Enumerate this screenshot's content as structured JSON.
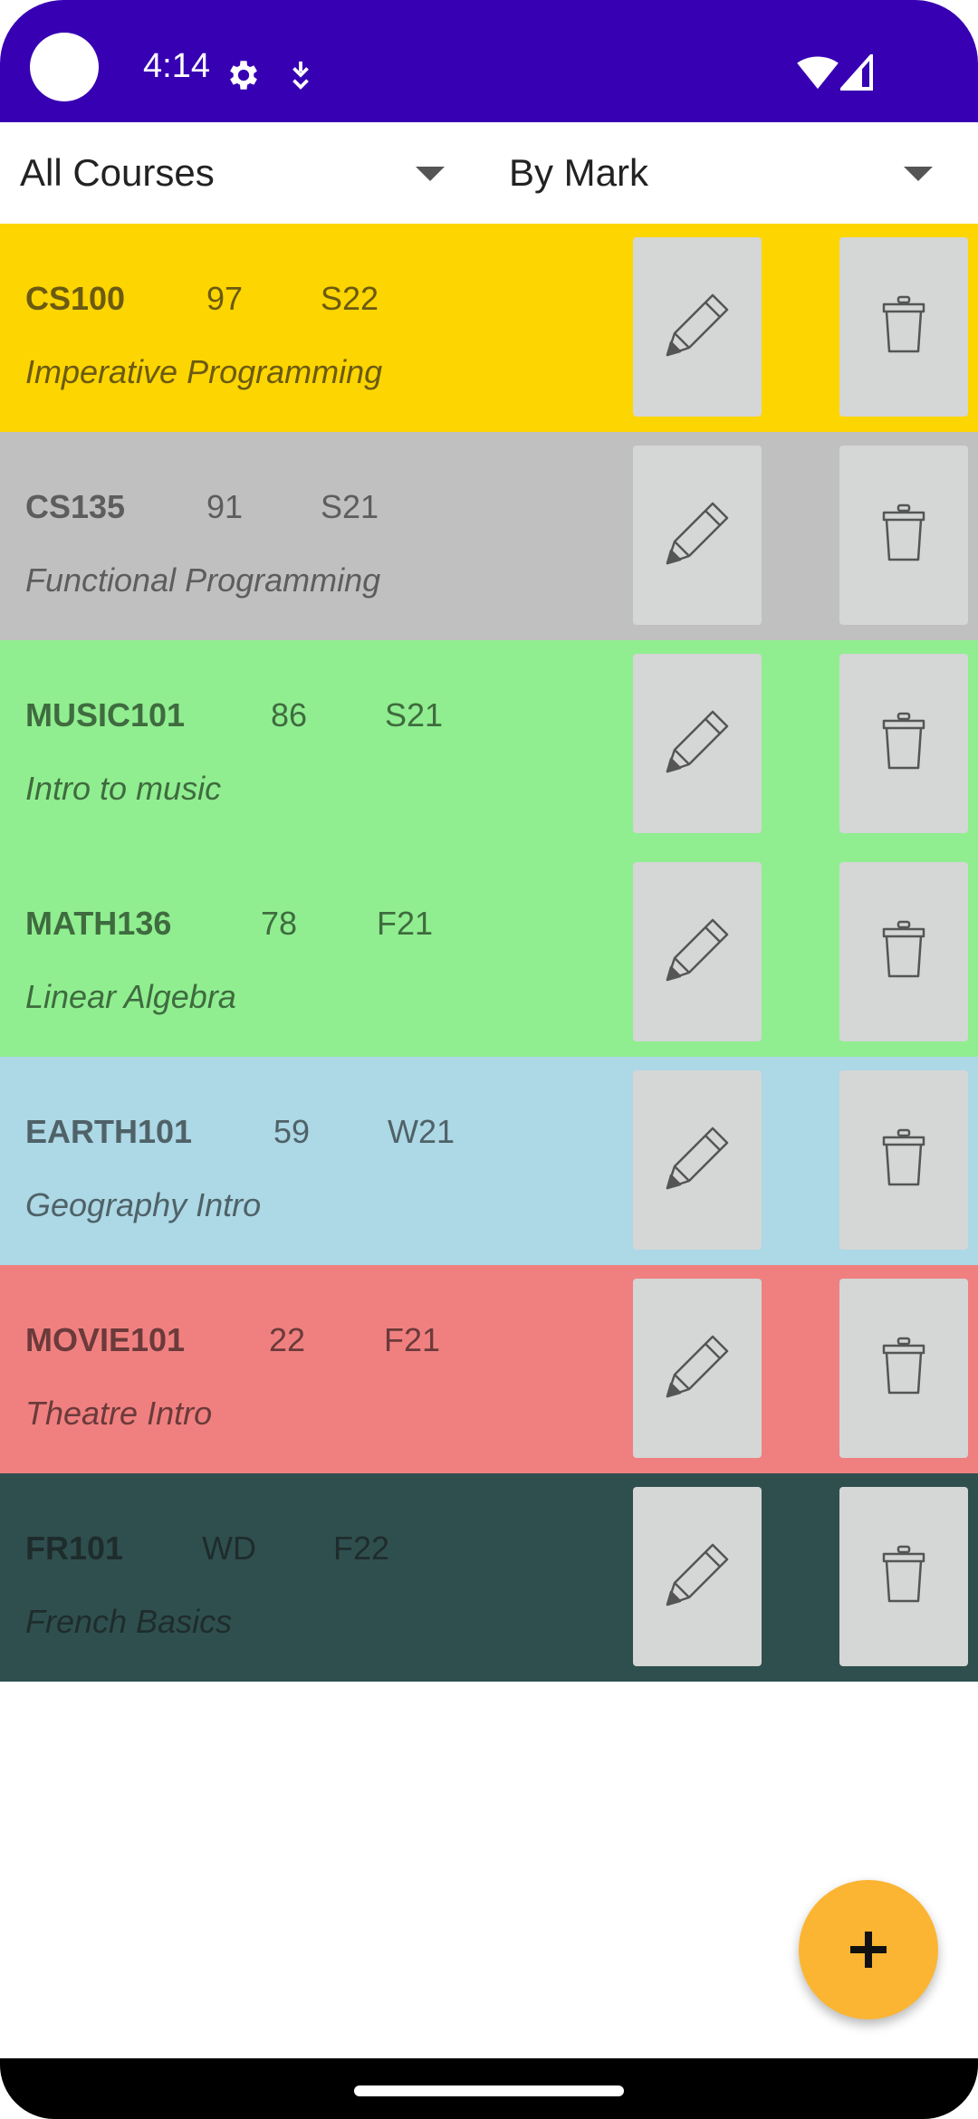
{
  "status_bar": {
    "time": "4:14",
    "icons": [
      "settings-gear-icon",
      "download-icon",
      "wifi-icon",
      "cell-signal-icon"
    ]
  },
  "filters": {
    "course_filter": "All Courses",
    "sort_by": "By Mark"
  },
  "courses": [
    {
      "code": "CS100",
      "mark": "97",
      "term": "S22",
      "title": "Imperative Programming",
      "bg": "#fdd500",
      "fg": "#6b5a12"
    },
    {
      "code": "CS135",
      "mark": "91",
      "term": "S21",
      "title": "Functional Programming",
      "bg": "#c0c0c0",
      "fg": "#5d5d5d"
    },
    {
      "code": "MUSIC101",
      "mark": "86",
      "term": "S21",
      "title": "Intro to music",
      "bg": "#90ee90",
      "fg": "#3f6b3f"
    },
    {
      "code": "MATH136",
      "mark": "78",
      "term": "F21",
      "title": "Linear Algebra",
      "bg": "#90ee90",
      "fg": "#3f6b3f"
    },
    {
      "code": "EARTH101",
      "mark": "59",
      "term": "W21",
      "title": "Geography Intro",
      "bg": "#add8e6",
      "fg": "#4f6268"
    },
    {
      "code": "MOVIE101",
      "mark": "22",
      "term": "F21",
      "title": "Theatre Intro",
      "bg": "#f08080",
      "fg": "#6b3a3a"
    },
    {
      "code": "FR101",
      "mark": "WD",
      "term": "F22",
      "title": "French Basics",
      "bg": "#2f4f4f",
      "fg": "#1f2c2c"
    }
  ],
  "fab": {
    "label": "+",
    "icon": "plus-icon"
  },
  "colors": {
    "status_bar": "#3700b3",
    "fab": "#fbb532",
    "action_button": "#d5d6d6"
  }
}
